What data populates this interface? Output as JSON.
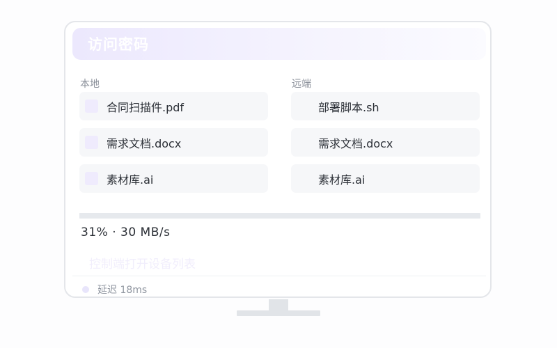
{
  "dialog": {
    "title": "访问密码"
  },
  "local": {
    "label": "本地",
    "files": [
      {
        "name": "合同扫描件.pdf"
      },
      {
        "name": "需求文档.docx"
      },
      {
        "name": "素材库.ai"
      }
    ]
  },
  "remote": {
    "label": "远端",
    "files": [
      {
        "name": "部署脚本.sh"
      },
      {
        "name": "需求文档.docx"
      },
      {
        "name": "素材库.ai"
      }
    ]
  },
  "transfer": {
    "progress_percent": 31,
    "progress_text": "31% · 30 MB/s"
  },
  "hint": "控制端打开设备列表",
  "status": {
    "latency_text": "延迟 18ms"
  },
  "colors": {
    "accent_light": "#ece8fd",
    "file_icon": "#efebfd",
    "track": "#e6e9ed"
  }
}
